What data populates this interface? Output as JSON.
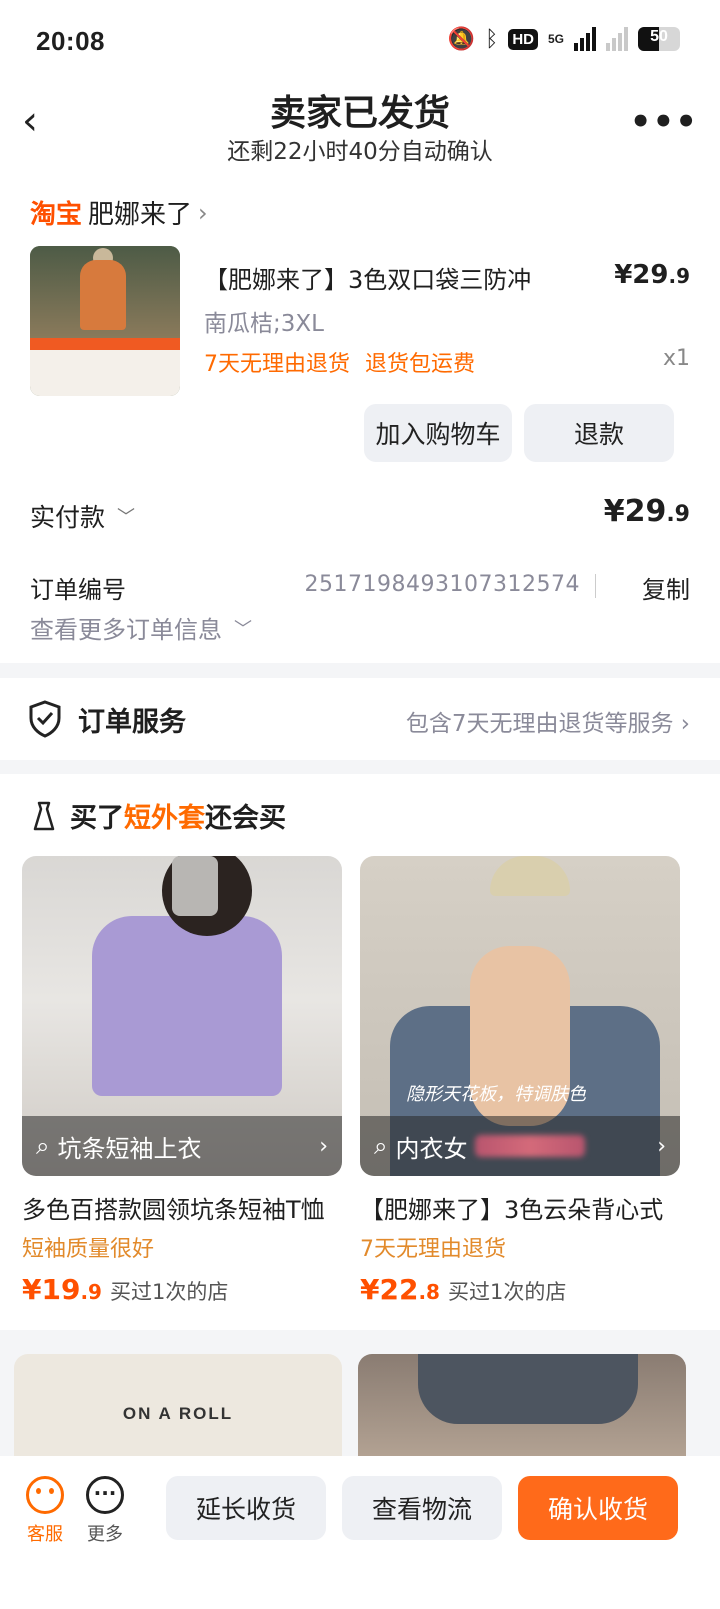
{
  "status_bar": {
    "time": "20:08",
    "hd": "HD",
    "net": "5G",
    "battery": "50"
  },
  "header": {
    "title": "卖家已发货",
    "subtitle": "还剩22小时40分自动确认"
  },
  "shop": {
    "platform": "淘宝",
    "name": "肥娜来了"
  },
  "product": {
    "name": "【肥娜来了】3色双口袋三防冲",
    "price_main": "¥29",
    "price_dec": ".9",
    "sku": "南瓜桔;3XL",
    "tags": "7天无理由退货 退货包运费",
    "qty": "x1"
  },
  "actions": {
    "add_cart": "加入购物车",
    "refund": "退款"
  },
  "payment": {
    "label": "实付款",
    "value_main": "¥29",
    "value_dec": ".9"
  },
  "order": {
    "label": "订单编号",
    "number": "2517198493107312574",
    "copy": "复制",
    "more_info": "查看更多订单信息"
  },
  "service": {
    "label": "订单服务",
    "detail": "包含7天无理由退货等服务"
  },
  "recommend": {
    "title_prefix": "买了",
    "title_keyword": "短外套",
    "title_suffix": "还会买",
    "items": [
      {
        "search": "坑条短袖上衣",
        "name": "多色百搭款圆领坑条短袖T恤",
        "tag": "短袖质量很好",
        "price_main": "¥19",
        "price_dec": ".9",
        "bought": "买过1次的店"
      },
      {
        "search": "内衣女",
        "name": "【肥娜来了】3色云朵背心式",
        "tag": "7天无理由退货",
        "price_main": "¥22",
        "price_dec": ".8",
        "bought": "买过1次的店",
        "overlay": "隐形天花板，特调肤色"
      }
    ],
    "next_image_text": "ON A ROLL"
  },
  "tabbar": {
    "service": "客服",
    "more": "更多",
    "extend": "延长收货",
    "logistics": "查看物流",
    "confirm": "确认收货"
  },
  "colors": {
    "accent": "#ff6a1a",
    "brand_taobao": "#ff5000",
    "tag_orange": "#ff6a00",
    "muted": "#8a8a99"
  }
}
